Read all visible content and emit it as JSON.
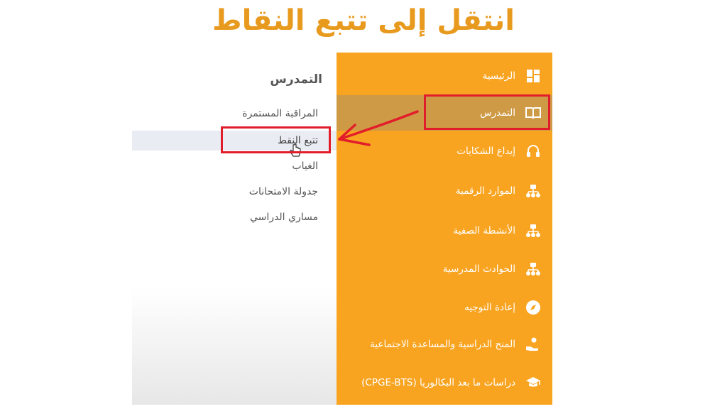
{
  "headline": "انتقل إلى تتبع النقاط",
  "submenu": {
    "title": "التمدرس",
    "items": [
      {
        "label": "المراقبة المستمرة"
      },
      {
        "label": "تتبع النقط"
      },
      {
        "label": "الغياب"
      },
      {
        "label": "جدولة الامتحانات"
      },
      {
        "label": "مساري الدراسي"
      }
    ]
  },
  "sidebar": {
    "items": [
      {
        "label": "الرئيسية",
        "icon": "dashboard-icon"
      },
      {
        "label": "التمدرس",
        "icon": "book-icon"
      },
      {
        "label": "إيداع الشكايات",
        "icon": "headset-icon"
      },
      {
        "label": "الموارد الرقمية",
        "icon": "network-icon"
      },
      {
        "label": "الأنشطة الصفية",
        "icon": "network-icon"
      },
      {
        "label": "الحوادث المدرسية",
        "icon": "network-icon"
      },
      {
        "label": "إعادة التوجيه",
        "icon": "compass-icon"
      },
      {
        "label": "المنح الدراسية والمساعدة الاجتماعية",
        "icon": "hand-coin-icon"
      },
      {
        "label": "دراسات ما بعد البكالوريا (CPGE-BTS)",
        "icon": "graduation-cap-icon"
      }
    ]
  },
  "colors": {
    "accent": "#f8a421",
    "active": "#cf9a45",
    "annotation": "#e21d2b",
    "headline": "#e89a1e"
  }
}
